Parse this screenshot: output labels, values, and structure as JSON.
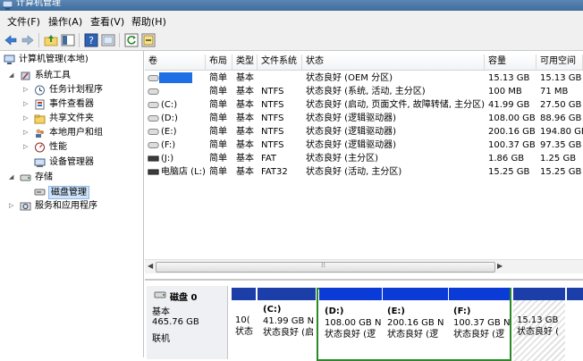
{
  "window": {
    "title": "计算机管理"
  },
  "menu": [
    {
      "label": "文件(F)"
    },
    {
      "label": "操作(A)"
    },
    {
      "label": "查看(V)"
    },
    {
      "label": "帮助(H)"
    }
  ],
  "toolbar": [
    {
      "icon": "back-icon"
    },
    {
      "icon": "forward-icon"
    },
    {
      "icon": "up-folder-icon"
    },
    {
      "icon": "show-hide-tree-icon"
    },
    {
      "icon": "help-icon"
    },
    {
      "icon": "properties-icon"
    },
    {
      "icon": "refresh-icon"
    },
    {
      "icon": "export-icon"
    }
  ],
  "tree": {
    "root": "计算机管理(本地)",
    "system_tools": "系统工具",
    "task_scheduler": "任务计划程序",
    "event_viewer": "事件查看器",
    "shared_folders": "共享文件夹",
    "local_users": "本地用户和组",
    "performance": "性能",
    "device_manager": "设备管理器",
    "storage": "存储",
    "disk_management": "磁盘管理",
    "services": "服务和应用程序"
  },
  "table": {
    "columns": [
      "卷",
      "布局",
      "类型",
      "文件系统",
      "状态",
      "容量",
      "可用空间"
    ],
    "rows": [
      {
        "vol": "",
        "layout": "简单",
        "type": "基本",
        "fs": "",
        "status": "状态良好 (OEM 分区)",
        "cap": "15.13 GB",
        "free": "15.13 GB",
        "icon": "volume-icon"
      },
      {
        "vol": "",
        "layout": "简单",
        "type": "基本",
        "fs": "NTFS",
        "status": "状态良好 (系统, 活动, 主分区)",
        "cap": "100 MB",
        "free": "71 MB",
        "icon": "volume-icon"
      },
      {
        "vol": "(C:)",
        "layout": "简单",
        "type": "基本",
        "fs": "NTFS",
        "status": "状态良好 (启动, 页面文件, 故障转储, 主分区)",
        "cap": "41.99 GB",
        "free": "27.50 GB",
        "icon": "volume-icon"
      },
      {
        "vol": "(D:)",
        "layout": "简单",
        "type": "基本",
        "fs": "NTFS",
        "status": "状态良好 (逻辑驱动器)",
        "cap": "108.00 GB",
        "free": "88.96 GB",
        "icon": "volume-icon"
      },
      {
        "vol": "(E:)",
        "layout": "简单",
        "type": "基本",
        "fs": "NTFS",
        "status": "状态良好 (逻辑驱动器)",
        "cap": "200.16 GB",
        "free": "194.80 GB",
        "icon": "volume-icon"
      },
      {
        "vol": "(F:)",
        "layout": "简单",
        "type": "基本",
        "fs": "NTFS",
        "status": "状态良好 (逻辑驱动器)",
        "cap": "100.37 GB",
        "free": "97.35 GB",
        "icon": "volume-icon"
      },
      {
        "vol": "(J:)",
        "layout": "简单",
        "type": "基本",
        "fs": "FAT",
        "status": "状态良好 (主分区)",
        "cap": "1.86 GB",
        "free": "1.25 GB",
        "icon": "removable-drive-icon"
      },
      {
        "vol": "电脑店 (L:)",
        "layout": "简单",
        "type": "基本",
        "fs": "FAT32",
        "status": "状态良好 (活动, 主分区)",
        "cap": "15.25 GB",
        "free": "15.25 GB",
        "icon": "removable-drive-icon"
      }
    ]
  },
  "disk": {
    "name": "磁盘 0",
    "type": "基本",
    "size": "465.76 GB",
    "state": "联机",
    "partitions": [
      {
        "line1": "",
        "line2": "10(",
        "line3": "状态"
      },
      {
        "line1": "(C:)",
        "line2": "41.99 GB N",
        "line3": "状态良好 (启"
      },
      {
        "line1": "(D:)",
        "line2": "108.00 GB N",
        "line3": "状态良好 (逻"
      },
      {
        "line1": "(E:)",
        "line2": "200.16 GB N",
        "line3": "状态良好 (逻"
      },
      {
        "line1": "(F:)",
        "line2": "100.37 GB N",
        "line3": "状态良好 (逻"
      },
      {
        "line1": "",
        "line2": "15.13 GB",
        "line3": "状态良好 ("
      }
    ]
  },
  "colors": {
    "primary_partition": "#1c3ea8",
    "logical_drive": "#0a3bd6",
    "extended_partition_border": "#2a8a2a",
    "selection": "#cfe3fa"
  }
}
